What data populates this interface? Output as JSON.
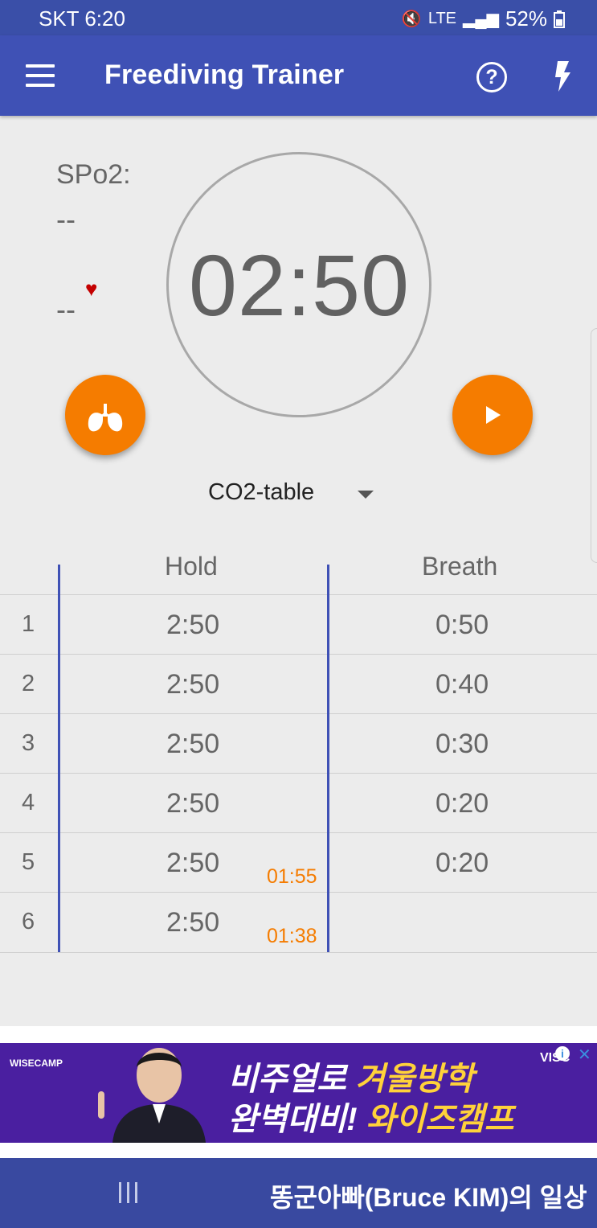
{
  "status_bar": {
    "carrier_time": "SKT 6:20",
    "signal_icons": "LTE",
    "battery": "52%"
  },
  "app_bar": {
    "title": "Freediving Trainer",
    "menu_icon": "hamburger-menu-icon",
    "help_icon": "help-circle-icon",
    "flash_icon": "lightning-bolt-icon"
  },
  "sensors": {
    "spo2_label": "SPo2:",
    "spo2_value": "--",
    "pulse_value": "--",
    "heart_icon": "heart-icon"
  },
  "timer": {
    "display": "02:50"
  },
  "actions": {
    "breathe_icon": "lungs-icon",
    "play_icon": "play-icon",
    "accent_color": "#f57c00"
  },
  "table_selector": {
    "selected": "CO2-table"
  },
  "table": {
    "headers": {
      "hold": "Hold",
      "breath": "Breath"
    },
    "rows": [
      {
        "num": "1",
        "hold": "2:50",
        "breath": "0:50",
        "actual": ""
      },
      {
        "num": "2",
        "hold": "2:50",
        "breath": "0:40",
        "actual": ""
      },
      {
        "num": "3",
        "hold": "2:50",
        "breath": "0:30",
        "actual": ""
      },
      {
        "num": "4",
        "hold": "2:50",
        "breath": "0:20",
        "actual": ""
      },
      {
        "num": "5",
        "hold": "2:50",
        "breath": "0:20",
        "actual": "01:55"
      },
      {
        "num": "6",
        "hold": "2:50",
        "breath": "",
        "actual": "01:38"
      }
    ]
  },
  "ad": {
    "brand": "WISECAMP",
    "line1_white": "비주얼로 ",
    "line1_highlight": "겨울방학",
    "line2_white": "완벽대비! ",
    "line2_highlight": "와이즈캠프",
    "partner": "VISC"
  },
  "nav_bar": {
    "caption": "똥군아빠(Bruce KIM)의 일상"
  },
  "colors": {
    "primary": "#3f51b5",
    "status_bar": "#3a4fa8",
    "accent": "#f57c00"
  }
}
